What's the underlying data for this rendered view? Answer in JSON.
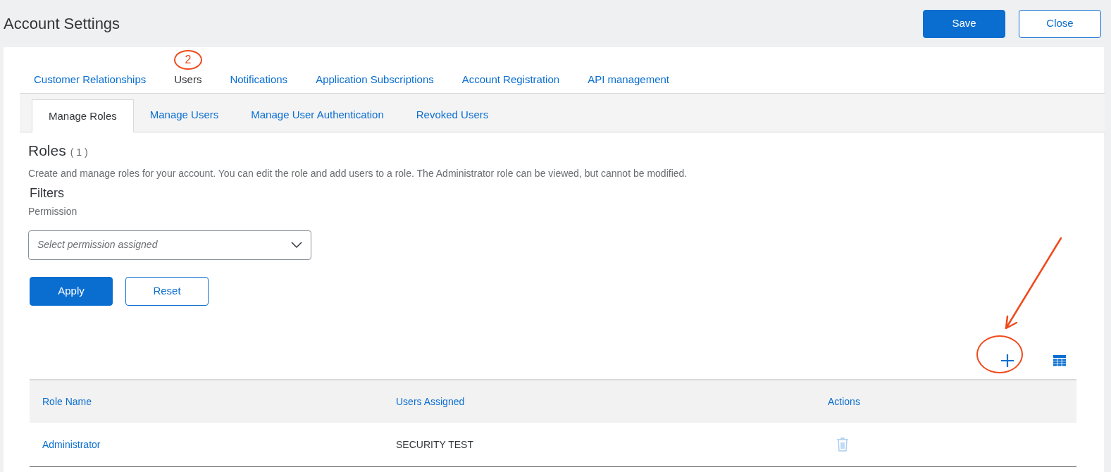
{
  "header": {
    "title": "Account Settings",
    "buttons": [
      {
        "label": "Save",
        "kind": "primary"
      },
      {
        "label": "Close",
        "kind": "secondary"
      }
    ]
  },
  "tabs": [
    {
      "label": "Customer Relationships",
      "selected": false
    },
    {
      "label": "Users",
      "selected": true,
      "annotation": "2"
    },
    {
      "label": "Notifications",
      "selected": false
    },
    {
      "label": "Application Subscriptions",
      "selected": false
    },
    {
      "label": "Account Registration",
      "selected": false
    },
    {
      "label": "API management",
      "selected": false
    }
  ],
  "subtabs": [
    {
      "label": "Manage Roles",
      "selected": true
    },
    {
      "label": "Manage Users",
      "selected": false
    },
    {
      "label": "Manage User Authentication",
      "selected": false
    },
    {
      "label": "Revoked Users",
      "selected": false
    }
  ],
  "roles": {
    "title": "Roles",
    "count": "( 1 )",
    "description": "Create and manage roles for your account. You can edit the role and add users to a role. The Administrator role can be viewed, but cannot be modified."
  },
  "filters": {
    "title": "Filters",
    "field_label": "Permission",
    "placeholder": "Select permission assigned",
    "buttons": [
      {
        "label": "Apply",
        "kind": "primary"
      },
      {
        "label": "Reset",
        "kind": "secondary"
      }
    ]
  },
  "table": {
    "columns": [
      "Role Name",
      "Users Assigned",
      "Actions"
    ],
    "rows": [
      {
        "role": "Administrator",
        "users": "SECURITY TEST",
        "delete_disabled": true
      }
    ]
  }
}
